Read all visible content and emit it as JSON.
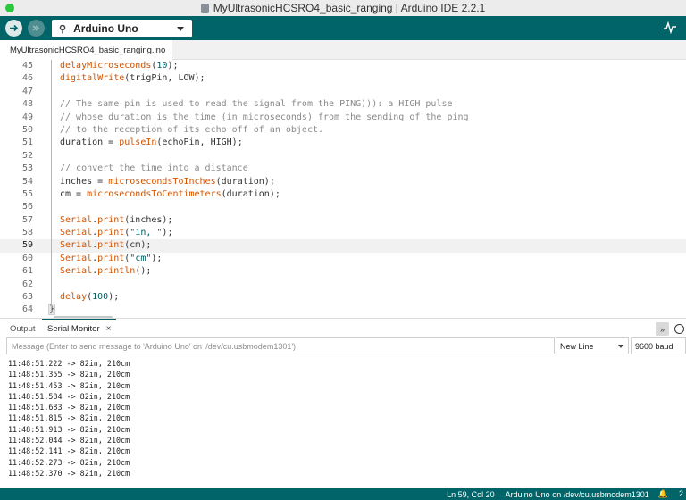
{
  "window": {
    "title": "MyUltrasonicHCSRO4_basic_ranging | Arduino IDE 2.2.1"
  },
  "toolbar": {
    "board": "Arduino Uno"
  },
  "file_tab": "MyUltrasonicHCSRO4_basic_ranging.ino",
  "editor": {
    "active_line": 59,
    "lines": [
      {
        "n": "45",
        "tokens": [
          {
            "t": "delayMicroseconds",
            "c": "fn"
          },
          {
            "t": "(",
            "c": ""
          },
          {
            "t": "10",
            "c": "num"
          },
          {
            "t": ");",
            "c": ""
          }
        ]
      },
      {
        "n": "46",
        "tokens": [
          {
            "t": "digitalWrite",
            "c": "fn"
          },
          {
            "t": "(trigPin, LOW);",
            "c": ""
          }
        ]
      },
      {
        "n": "47",
        "tokens": []
      },
      {
        "n": "48",
        "tokens": [
          {
            "t": "// The same pin is used to read the signal from the PING))): a HIGH pulse",
            "c": "cmt"
          }
        ]
      },
      {
        "n": "49",
        "tokens": [
          {
            "t": "// whose duration is the time (in microseconds) from the sending of the ping",
            "c": "cmt"
          }
        ]
      },
      {
        "n": "50",
        "tokens": [
          {
            "t": "// to the reception of its echo off of an object.",
            "c": "cmt"
          }
        ]
      },
      {
        "n": "51",
        "tokens": [
          {
            "t": "duration = ",
            "c": ""
          },
          {
            "t": "pulseIn",
            "c": "fn"
          },
          {
            "t": "(echoPin, HIGH);",
            "c": ""
          }
        ]
      },
      {
        "n": "52",
        "tokens": []
      },
      {
        "n": "53",
        "tokens": [
          {
            "t": "// convert the time into a distance",
            "c": "cmt"
          }
        ]
      },
      {
        "n": "54",
        "tokens": [
          {
            "t": "inches = ",
            "c": ""
          },
          {
            "t": "microsecondsToInches",
            "c": "fn"
          },
          {
            "t": "(duration);",
            "c": ""
          }
        ]
      },
      {
        "n": "55",
        "tokens": [
          {
            "t": "cm = ",
            "c": ""
          },
          {
            "t": "microsecondsToCentimeters",
            "c": "fn"
          },
          {
            "t": "(duration);",
            "c": ""
          }
        ]
      },
      {
        "n": "56",
        "tokens": []
      },
      {
        "n": "57",
        "tokens": [
          {
            "t": "Serial",
            "c": "cls"
          },
          {
            "t": ".",
            "c": ""
          },
          {
            "t": "print",
            "c": "fn"
          },
          {
            "t": "(inches);",
            "c": ""
          }
        ]
      },
      {
        "n": "58",
        "tokens": [
          {
            "t": "Serial",
            "c": "cls"
          },
          {
            "t": ".",
            "c": ""
          },
          {
            "t": "print",
            "c": "fn"
          },
          {
            "t": "(",
            "c": ""
          },
          {
            "t": "\"in, \"",
            "c": "str"
          },
          {
            "t": ");",
            "c": ""
          }
        ]
      },
      {
        "n": "59",
        "tokens": [
          {
            "t": "Serial",
            "c": "cls"
          },
          {
            "t": ".",
            "c": ""
          },
          {
            "t": "print",
            "c": "fn"
          },
          {
            "t": "(cm);",
            "c": ""
          }
        ]
      },
      {
        "n": "60",
        "tokens": [
          {
            "t": "Serial",
            "c": "cls"
          },
          {
            "t": ".",
            "c": ""
          },
          {
            "t": "print",
            "c": "fn"
          },
          {
            "t": "(",
            "c": ""
          },
          {
            "t": "\"cm\"",
            "c": "str"
          },
          {
            "t": ");",
            "c": ""
          }
        ]
      },
      {
        "n": "61",
        "tokens": [
          {
            "t": "Serial",
            "c": "cls"
          },
          {
            "t": ".",
            "c": ""
          },
          {
            "t": "println",
            "c": "fn"
          },
          {
            "t": "();",
            "c": ""
          }
        ]
      },
      {
        "n": "62",
        "tokens": []
      },
      {
        "n": "63",
        "tokens": [
          {
            "t": "delay",
            "c": "fn"
          },
          {
            "t": "(",
            "c": ""
          },
          {
            "t": "100",
            "c": "num"
          },
          {
            "t": ");",
            "c": ""
          }
        ]
      },
      {
        "n": "64",
        "tokens": [
          {
            "t": "}",
            "c": "brace"
          }
        ],
        "nonindent": true
      }
    ]
  },
  "panel": {
    "tabs": {
      "output": "Output",
      "serial_monitor": "Serial Monitor",
      "close": "×"
    },
    "message_placeholder": "Message (Enter to send message to 'Arduino Uno' on '/dev/cu.usbmodem1301')",
    "line_ending": "New Line",
    "baud": "9600 baud"
  },
  "serial_output": [
    "11:48:51.222 -> 82in, 210cm",
    "11:48:51.355 -> 82in, 210cm",
    "11:48:51.453 -> 82in, 210cm",
    "11:48:51.584 -> 82in, 210cm",
    "11:48:51.683 -> 82in, 210cm",
    "11:48:51.815 -> 82in, 210cm",
    "11:48:51.913 -> 82in, 210cm",
    "11:48:52.044 -> 82in, 210cm",
    "11:48:52.141 -> 82in, 210cm",
    "11:48:52.273 -> 82in, 210cm",
    "11:48:52.370 -> 82in, 210cm"
  ],
  "status": {
    "cursor": "Ln 59, Col 20",
    "board_port": "Arduino Uno on /dev/cu.usbmodem1301",
    "notifications": "2"
  },
  "colors": {
    "accent": "#006468",
    "keyword": "#d35400",
    "string": "#005c5f",
    "comment": "#8a8a8a"
  },
  "icons": [
    "verify-icon",
    "upload-icon",
    "usb-icon",
    "serial-plotter-icon",
    "toggle-autoscroll-icon",
    "timestamp-icon",
    "notification-icon"
  ]
}
